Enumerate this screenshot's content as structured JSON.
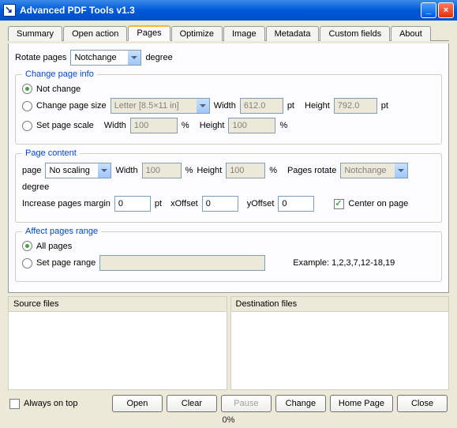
{
  "window": {
    "title": "Advanced PDF Tools  v1.3"
  },
  "tabs": {
    "items": [
      "Summary",
      "Open action",
      "Pages",
      "Optimize",
      "Image",
      "Metadata",
      "Custom fields",
      "About"
    ],
    "active": 2
  },
  "rotate": {
    "label": "Rotate pages",
    "value": "Notchange",
    "unit": "degree"
  },
  "changeInfo": {
    "legend": "Change page info",
    "notchange": "Not change",
    "changesize": "Change page size",
    "sizeValue": "Letter [8.5×11 in]",
    "widthLbl": "Width",
    "widthVal": "612.0",
    "widthUnit": "pt",
    "heightLbl": "Height",
    "heightVal": "792.0",
    "heightUnit": "pt",
    "scale": "Set page scale",
    "scaleWidthLbl": "Width",
    "scaleWidthVal": "100",
    "scaleWidthUnit": "%",
    "scaleHeightLbl": "Height",
    "scaleHeightVal": "100",
    "scaleHeightUnit": "%"
  },
  "pageContent": {
    "legend": "Page content",
    "pageLbl": "page",
    "pageVal": "No scaling",
    "widthLbl": "Width",
    "widthVal": "100",
    "widthUnit": "%",
    "heightLbl": "Height",
    "heightVal": "100",
    "heightUnit": "%",
    "rotateLbl": "Pages rotate",
    "rotateVal": "Notchange",
    "rotateUnit": "degree",
    "marginLbl": "Increase pages margin",
    "marginVal": "0",
    "marginUnit": "pt",
    "xoffLbl": "xOffset",
    "xoffVal": "0",
    "yoffLbl": "yOffset",
    "yoffVal": "0",
    "centerLbl": "Center on page"
  },
  "range": {
    "legend": "Affect pages range",
    "all": "All pages",
    "set": "Set page range",
    "example": "Example: 1,2,3,7,12-18,19"
  },
  "files": {
    "src": "Source files",
    "dst": "Destination files"
  },
  "footer": {
    "always": "Always on top",
    "open": "Open",
    "clear": "Clear",
    "pause": "Pause",
    "change": "Change",
    "home": "Home Page",
    "close": "Close"
  },
  "status": "0%"
}
